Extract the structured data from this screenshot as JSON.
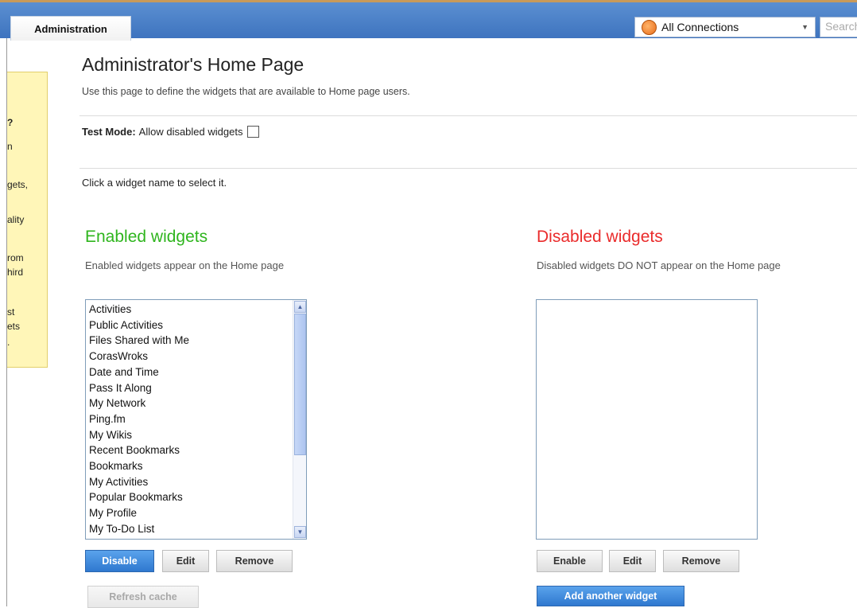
{
  "header": {
    "tab_label": "Administration",
    "connections_label": "All Connections",
    "search_placeholder": "Search"
  },
  "help_fragments": [
    "?",
    "n",
    "gets,",
    "ality",
    "rom",
    "hird",
    "st",
    "ets",
    "."
  ],
  "page": {
    "title": "Administrator's Home Page",
    "subtitle": "Use this page to define the widgets that are available to Home page users.",
    "test_mode_label": "Test Mode:",
    "test_mode_text": "Allow disabled widgets",
    "instruction": "Click a widget name to select it."
  },
  "enabled": {
    "title": "Enabled widgets",
    "description": "Enabled widgets appear on the Home page",
    "items": [
      "Activities",
      "Public Activities",
      "Files Shared with Me",
      "CorasWroks",
      "Date and Time",
      "Pass It Along",
      "My Network",
      "Ping.fm",
      "My Wikis",
      "Recent Bookmarks",
      "Bookmarks",
      "My Activities",
      "Popular Bookmarks",
      "My Profile",
      "My To-Do List"
    ],
    "buttons": {
      "disable": "Disable",
      "edit": "Edit",
      "remove": "Remove",
      "refresh": "Refresh cache"
    }
  },
  "disabled": {
    "title": "Disabled widgets",
    "description": "Disabled widgets DO NOT appear on the Home page",
    "buttons": {
      "enable": "Enable",
      "edit": "Edit",
      "remove": "Remove",
      "add": "Add another widget"
    }
  },
  "colors": {
    "enabled_title": "#2fb51e",
    "disabled_title": "#ea2b2b",
    "header_blue": "#4a80c8",
    "primary_button": "#3a86dc"
  }
}
